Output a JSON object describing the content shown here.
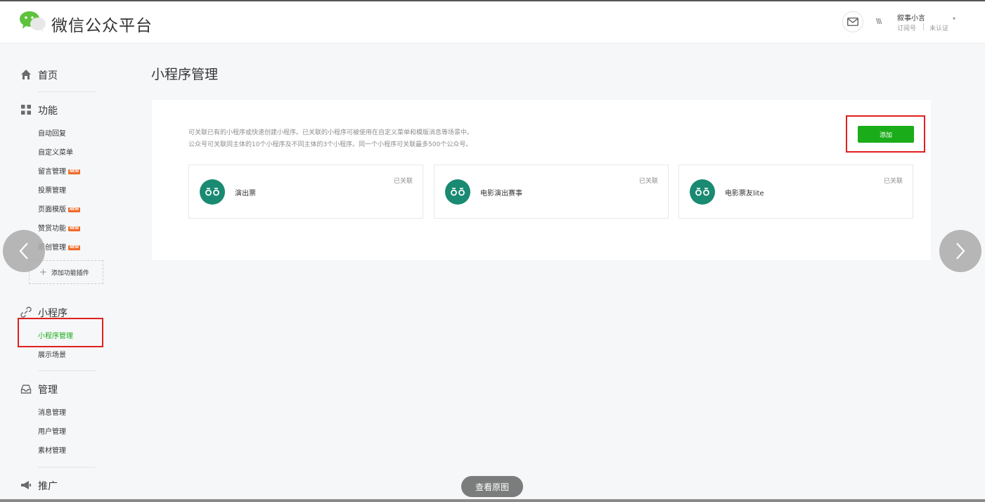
{
  "header": {
    "brand": "微信公众平台",
    "account_name": "叙事小言",
    "account_type": "订阅号",
    "account_status": "未认证",
    "avatar_text": "\\\\\\"
  },
  "sidebar": {
    "home": "首页",
    "functions": {
      "title": "功能",
      "items": [
        {
          "label": "自动回复",
          "badge": ""
        },
        {
          "label": "自定义菜单",
          "badge": ""
        },
        {
          "label": "留言管理",
          "badge": "NEW"
        },
        {
          "label": "投票管理",
          "badge": ""
        },
        {
          "label": "页面模版",
          "badge": "NEW"
        },
        {
          "label": "赞赏功能",
          "badge": "NEW"
        },
        {
          "label": "原创管理",
          "badge": "NEW"
        }
      ],
      "add_plugin": "添加功能插件"
    },
    "miniprogram": {
      "title": "小程序",
      "items": [
        {
          "label": "小程序管理",
          "active": true
        },
        {
          "label": "展示场景",
          "active": false
        }
      ]
    },
    "manage": {
      "title": "管理",
      "items": [
        {
          "label": "消息管理"
        },
        {
          "label": "用户管理"
        },
        {
          "label": "素材管理"
        }
      ]
    },
    "promote": {
      "title": "推广"
    }
  },
  "main": {
    "title": "小程序管理",
    "desc_line1": "可关联已有的小程序或快速创建小程序。已关联的小程序可被使用在自定义菜单和模版消息等场景中。",
    "desc_line2": "公众号可关联同主体的10个小程序及不同主体的3个小程序。同一个小程序可关联最多500个公众号。",
    "add_button": "添加",
    "cards": [
      {
        "name": "演出票",
        "status": "已关联"
      },
      {
        "name": "电影演出赛事",
        "status": "已关联"
      },
      {
        "name": "电影票友lite",
        "status": "已关联"
      }
    ]
  },
  "viewer": {
    "view_original": "查看原图"
  },
  "colors": {
    "accent": "#1aad19",
    "highlight_box": "#e02020",
    "card_logo": "#1a8a72",
    "new_badge": "#f06a2a"
  }
}
